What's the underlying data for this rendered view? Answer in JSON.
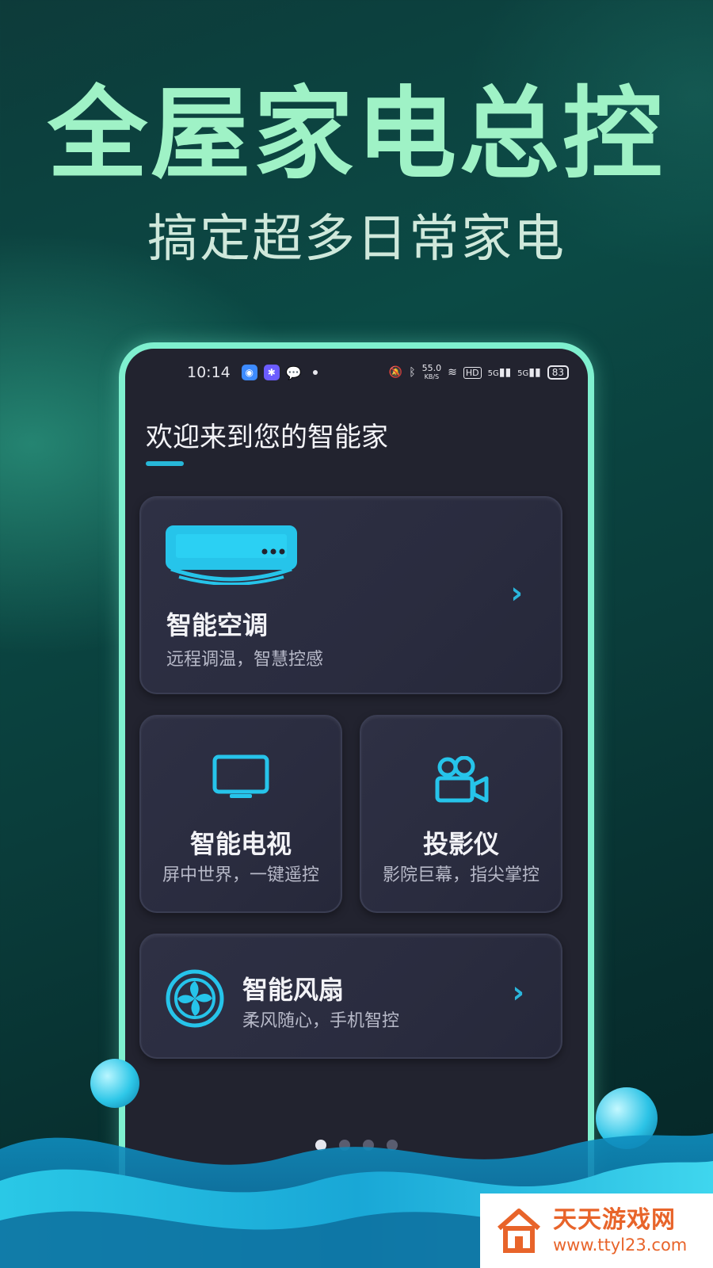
{
  "hero": {
    "title": "全屋家电总控",
    "subtitle": "搞定超多日常家电"
  },
  "status_bar": {
    "time": "10:14",
    "net_rate_value": "55.0",
    "net_rate_unit": "KB/S",
    "hd_label": "HD",
    "signal1_label": "5G",
    "signal2_label": "5G",
    "battery": "83"
  },
  "screen": {
    "welcome": "欢迎来到您的智能家",
    "cards": {
      "ac": {
        "title": "智能空调",
        "subtitle": "远程调温，智慧控感",
        "icon": "air-conditioner-icon"
      },
      "tv": {
        "title": "智能电视",
        "subtitle": "屏中世界，一键遥控",
        "icon": "tv-icon"
      },
      "projector": {
        "title": "投影仪",
        "subtitle": "影院巨幕，指尖掌控",
        "icon": "projector-camera-icon"
      },
      "fan": {
        "title": "智能风扇",
        "subtitle": "柔风随心，手机智控",
        "icon": "fan-icon"
      }
    },
    "pager": {
      "count": 4,
      "active_index": 0
    }
  },
  "watermark": {
    "name": "天天游戏网",
    "url": "www.ttyl23.com"
  },
  "colors": {
    "headline": "#9ff2c6",
    "accent": "#2ab6dc",
    "phone_border": "#7ff0cf",
    "phone_bg": "#22232f",
    "watermark": "#e8642a"
  }
}
